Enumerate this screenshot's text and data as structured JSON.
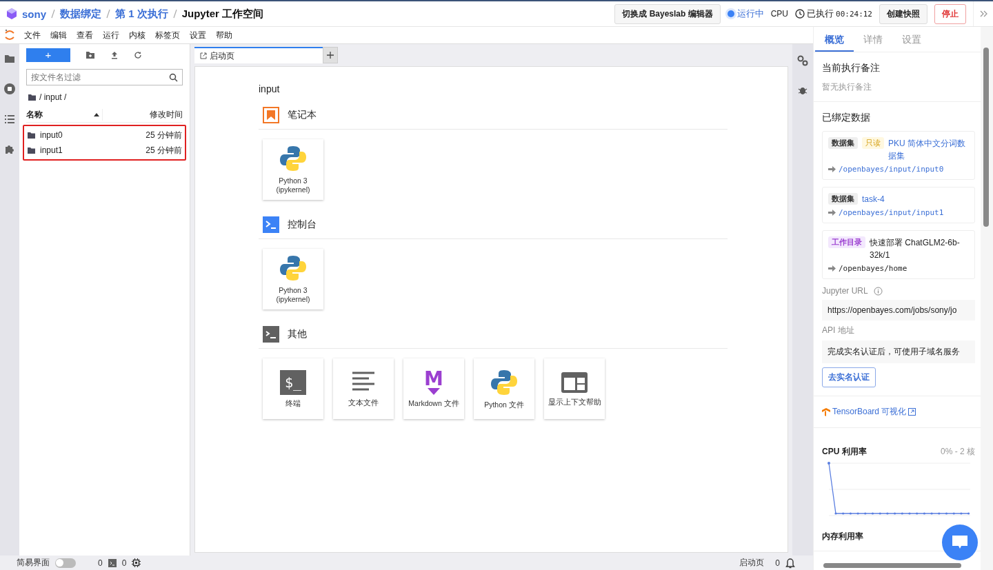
{
  "breadcrumb": [
    {
      "label": "sony",
      "kind": "link"
    },
    {
      "label": "数据绑定",
      "kind": "link"
    },
    {
      "label": "第 1 次执行",
      "kind": "link"
    },
    {
      "label": "Jupyter 工作空间",
      "kind": "current"
    }
  ],
  "header": {
    "switch_button": "切换成 Bayeslab 编辑器",
    "status": "运行中",
    "resource": "CPU",
    "elapsed_label": "已执行",
    "elapsed": "00:24:12",
    "snapshot_button": "创建快照",
    "stop_button": "停止"
  },
  "menu": [
    "文件",
    "编辑",
    "查看",
    "运行",
    "内核",
    "标签页",
    "设置",
    "帮助"
  ],
  "file_browser": {
    "new_button": "+",
    "filter_placeholder": "按文件名过滤",
    "path": "/ input /",
    "columns": [
      "名称",
      "修改时间"
    ],
    "rows_highlighted": true,
    "rows": [
      {
        "name": "input0",
        "modified": "25 分钟前",
        "selected": false
      },
      {
        "name": "input1",
        "modified": "25 分钟前",
        "selected": false
      }
    ]
  },
  "tabs": [
    {
      "label": "启动页",
      "selected": true
    }
  ],
  "launcher": {
    "title": "input",
    "sections": [
      {
        "kind": "notebook",
        "title": "笔记本",
        "cards": [
          {
            "kind": "python",
            "lines": [
              "Python 3",
              "(ipykernel)"
            ]
          }
        ]
      },
      {
        "kind": "console",
        "title": "控制台",
        "cards": [
          {
            "kind": "python",
            "lines": [
              "Python 3",
              "(ipykernel)"
            ]
          }
        ]
      },
      {
        "kind": "other",
        "title": "其他",
        "cards": [
          {
            "kind": "terminal",
            "icon_text": "$_",
            "lines": [
              "终端"
            ]
          },
          {
            "kind": "text",
            "lines": [
              "文本文件"
            ]
          },
          {
            "kind": "markdown",
            "icon_text": "M",
            "lines": [
              "Markdown 文件"
            ]
          },
          {
            "kind": "python",
            "lines": [
              "Python 文件"
            ]
          },
          {
            "kind": "help",
            "lines": [
              "显示上下文帮助"
            ]
          }
        ]
      }
    ]
  },
  "right_panel": {
    "tabs": [
      {
        "label": "概览",
        "selected": true
      },
      {
        "label": "详情",
        "selected": false
      },
      {
        "label": "设置",
        "selected": false
      }
    ],
    "note": {
      "title": "当前执行备注",
      "text": "暂无执行备注"
    },
    "bound": {
      "title": "已绑定数据",
      "items": [
        {
          "kind": "dataset",
          "tag": "数据集",
          "badge": "只读",
          "name": "PKU 简体中文分词数据集",
          "path": "/openbayes/input/input0"
        },
        {
          "kind": "dataset",
          "tag": "数据集",
          "name": "task-4",
          "path": "/openbayes/input/input1"
        },
        {
          "kind": "workdir",
          "tag": "工作目录",
          "name": "快速部署 ChatGLM2-6b-32k/1",
          "path": "/openbayes/home"
        }
      ]
    },
    "jupyter_url": {
      "label": "Jupyter URL",
      "value": "https://openbayes.com/jobs/sony/jo"
    },
    "api": {
      "label": "API 地址",
      "value": "完成实名认证后，可使用子域名服务",
      "button": "去实名认证"
    },
    "tensorboard": "TensorBoard 可视化",
    "cpu": {
      "title": "CPU 利用率",
      "range": "0% - 2 核"
    },
    "memory": {
      "title": "内存利用率"
    }
  },
  "status_bar": {
    "simple_label": "简易界面",
    "simple_on": false,
    "kernels": "0",
    "terminals": "0",
    "tab": "启动页",
    "notifications": "0"
  }
}
